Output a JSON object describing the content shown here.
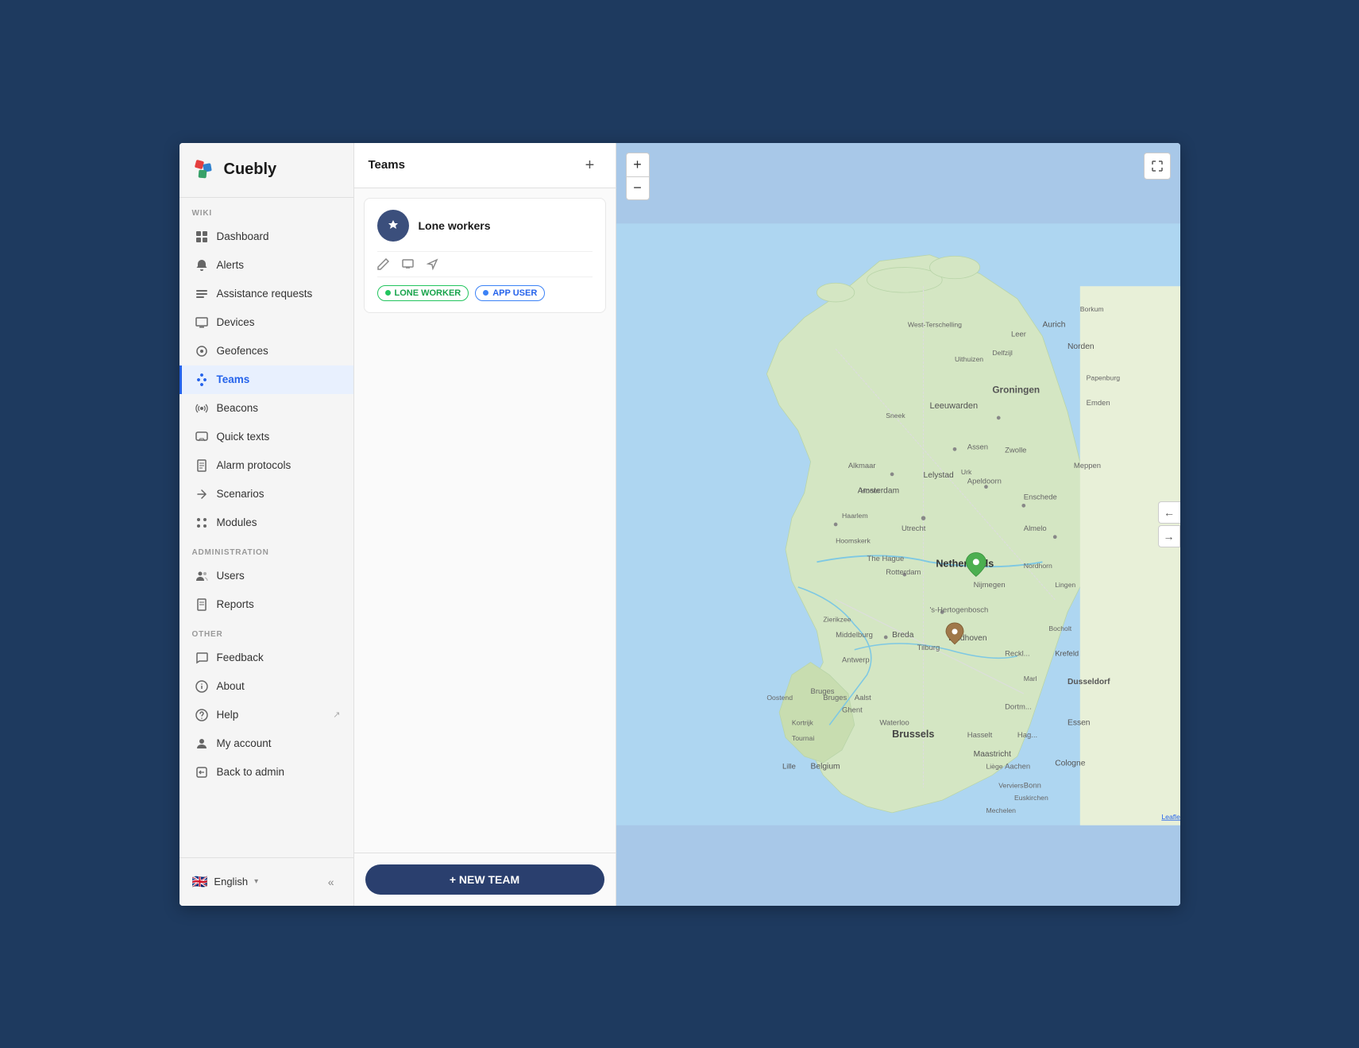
{
  "app": {
    "name": "Cuebly"
  },
  "sidebar": {
    "sections": [
      {
        "label": "WIKI",
        "items": [
          {
            "id": "dashboard",
            "label": "Dashboard",
            "icon": "grid"
          },
          {
            "id": "alerts",
            "label": "Alerts",
            "icon": "bell"
          },
          {
            "id": "assistance-requests",
            "label": "Assistance requests",
            "icon": "users"
          },
          {
            "id": "devices",
            "label": "Devices",
            "icon": "monitor"
          },
          {
            "id": "geofences",
            "label": "Geofences",
            "icon": "circle"
          },
          {
            "id": "teams",
            "label": "Teams",
            "icon": "link",
            "active": true
          },
          {
            "id": "beacons",
            "label": "Beacons",
            "icon": "radio"
          },
          {
            "id": "quick-texts",
            "label": "Quick texts",
            "icon": "message"
          },
          {
            "id": "alarm-protocols",
            "label": "Alarm protocols",
            "icon": "file"
          },
          {
            "id": "scenarios",
            "label": "Scenarios",
            "icon": "wrench"
          },
          {
            "id": "modules",
            "label": "Modules",
            "icon": "circle-grid"
          }
        ]
      },
      {
        "label": "ADMINISTRATION",
        "items": [
          {
            "id": "users",
            "label": "Users",
            "icon": "people"
          },
          {
            "id": "reports",
            "label": "Reports",
            "icon": "document"
          }
        ]
      },
      {
        "label": "OTHER",
        "items": [
          {
            "id": "feedback",
            "label": "Feedback",
            "icon": "comment"
          },
          {
            "id": "about",
            "label": "About",
            "icon": "info"
          },
          {
            "id": "help",
            "label": "Help",
            "icon": "question",
            "external": true
          },
          {
            "id": "my-account",
            "label": "My account",
            "icon": "user"
          },
          {
            "id": "back-to-admin",
            "label": "Back to admin",
            "icon": "arrow-left"
          }
        ]
      }
    ]
  },
  "language": {
    "label": "English",
    "flag": "🇬🇧"
  },
  "main_panel": {
    "title": "Teams",
    "add_button_label": "+",
    "teams": [
      {
        "id": "lone-workers",
        "name": "Lone workers",
        "avatar_letter": "⚡",
        "tags": [
          {
            "label": "LONE WORKER",
            "color": "green"
          },
          {
            "label": "APP USER",
            "color": "blue"
          }
        ]
      }
    ],
    "new_team_button": "+ NEW TEAM"
  },
  "map": {
    "zoom_in_label": "+",
    "zoom_out_label": "−",
    "leaflet_label": "Leaflet",
    "toggle_left": "←",
    "toggle_right": "→"
  }
}
